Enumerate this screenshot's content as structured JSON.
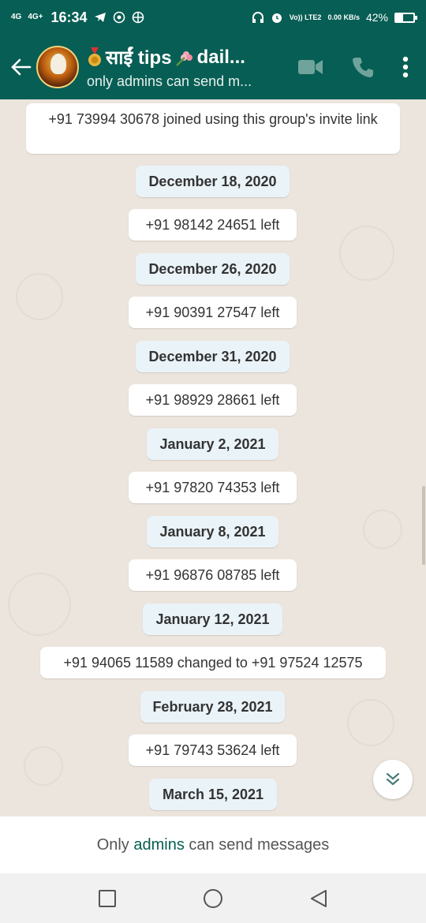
{
  "status_bar": {
    "net1": "4G",
    "net2": "4G+",
    "time": "16:34",
    "volte": "Vo)) LTE2",
    "speed": "0.00 KB/s",
    "battery_pct": "42%",
    "battery_level": 0.42
  },
  "header": {
    "title": "साईं tips",
    "title_suffix": "dail...",
    "subtitle": "only admins can send m..."
  },
  "messages": [
    {
      "type": "system",
      "text": "+91 73994 30678 joined using this group's invite link"
    },
    {
      "type": "date",
      "text": "December 18, 2020"
    },
    {
      "type": "system",
      "text": "+91 98142 24651 left"
    },
    {
      "type": "date",
      "text": "December 26, 2020"
    },
    {
      "type": "system",
      "text": "+91 90391 27547 left"
    },
    {
      "type": "date",
      "text": "December 31, 2020"
    },
    {
      "type": "system",
      "text": "+91 98929 28661 left"
    },
    {
      "type": "date",
      "text": "January 2, 2021"
    },
    {
      "type": "system",
      "text": "+91 97820 74353 left"
    },
    {
      "type": "date",
      "text": "January 8, 2021"
    },
    {
      "type": "system",
      "text": "+91 96876 08785 left"
    },
    {
      "type": "date",
      "text": "January 12, 2021"
    },
    {
      "type": "system",
      "text": "+91 94065 11589 changed to +91 97524 12575"
    },
    {
      "type": "date",
      "text": "February 28, 2021"
    },
    {
      "type": "system",
      "text": "+91 79743 53624 left"
    },
    {
      "type": "date",
      "text": "March 15, 2021"
    }
  ],
  "footer": {
    "prefix": "Only",
    "link": "admins",
    "suffix": "can send messages"
  },
  "colors": {
    "header": "#075e54",
    "chat_bg": "#ece5dd",
    "date_bubble": "#eaf3f8"
  }
}
